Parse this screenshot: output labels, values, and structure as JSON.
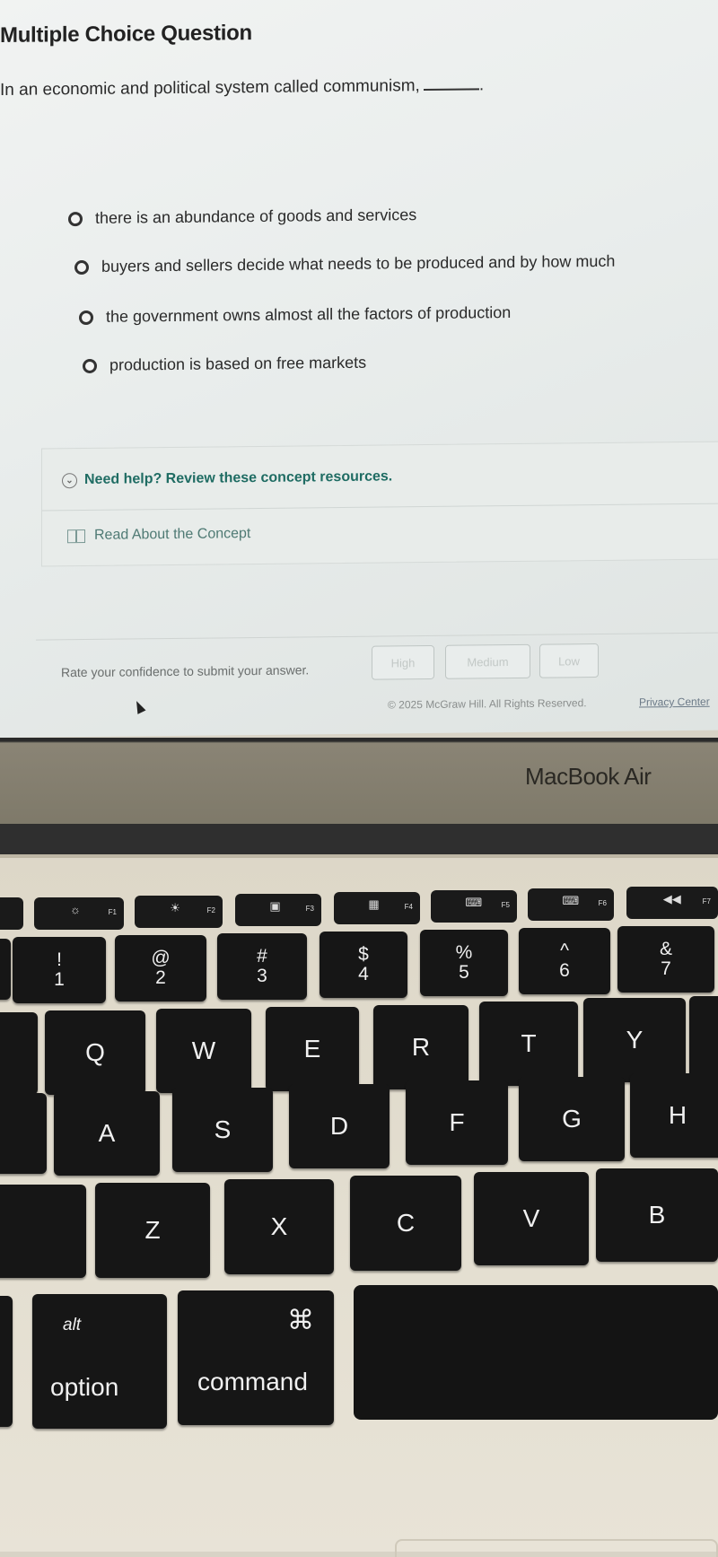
{
  "question": {
    "type_label": "Multiple Choice Question",
    "prompt": "In an economic and political system called communism,",
    "prompt_end": ".",
    "options": [
      "there is an abundance of goods and services",
      "buyers and sellers decide what needs to be produced and by how much",
      "the government owns almost all the factors of production",
      "production is based on free markets"
    ]
  },
  "help": {
    "toggle_label": "Need help? Review these concept resources.",
    "resource_label": "Read About the Concept"
  },
  "confidence": {
    "prompt": "Rate your confidence to submit your answer.",
    "buttons": [
      "High",
      "Medium",
      "Low"
    ]
  },
  "footer": {
    "copyright": "© 2025 McGraw Hill. All Rights Reserved.",
    "privacy_link": "Privacy Center"
  },
  "device": {
    "brand": "MacBook Air",
    "function_keys": [
      {
        "symbol": "☼",
        "label": "F1"
      },
      {
        "symbol": "☀",
        "label": "F2"
      },
      {
        "symbol": "▣",
        "label": "F3"
      },
      {
        "symbol": "▦",
        "label": "F4"
      },
      {
        "symbol": "⌨",
        "label": "F5"
      },
      {
        "symbol": "⌨",
        "label": "F6"
      },
      {
        "symbol": "◀◀",
        "label": "F7"
      }
    ],
    "number_keys": [
      {
        "top": "!",
        "bottom": "1"
      },
      {
        "top": "@",
        "bottom": "2"
      },
      {
        "top": "#",
        "bottom": "3"
      },
      {
        "top": "$",
        "bottom": "4"
      },
      {
        "top": "%",
        "bottom": "5"
      },
      {
        "top": "^",
        "bottom": "6"
      },
      {
        "top": "&",
        "bottom": "7"
      }
    ],
    "row_qwerty": [
      "Q",
      "W",
      "E",
      "R",
      "T",
      "Y"
    ],
    "row_asdf": [
      "A",
      "S",
      "D",
      "F",
      "G",
      "H"
    ],
    "row_zxcv": [
      "Z",
      "X",
      "C",
      "V",
      "B"
    ],
    "option_key": {
      "top": "alt",
      "bottom": "option"
    },
    "command_key": {
      "top": "⌘",
      "bottom": "command"
    }
  }
}
